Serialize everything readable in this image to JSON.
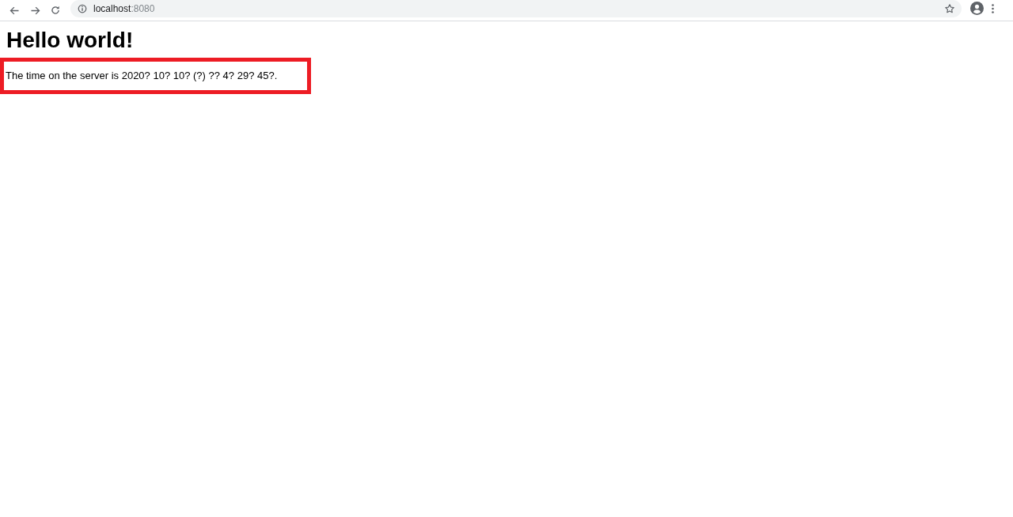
{
  "browser": {
    "address": {
      "host": "localhost",
      "port": ":8080"
    }
  },
  "page": {
    "heading": "Hello world!",
    "message": "The time on the server is 2020? 10? 10? (?) ?? 4? 29? 45?."
  }
}
